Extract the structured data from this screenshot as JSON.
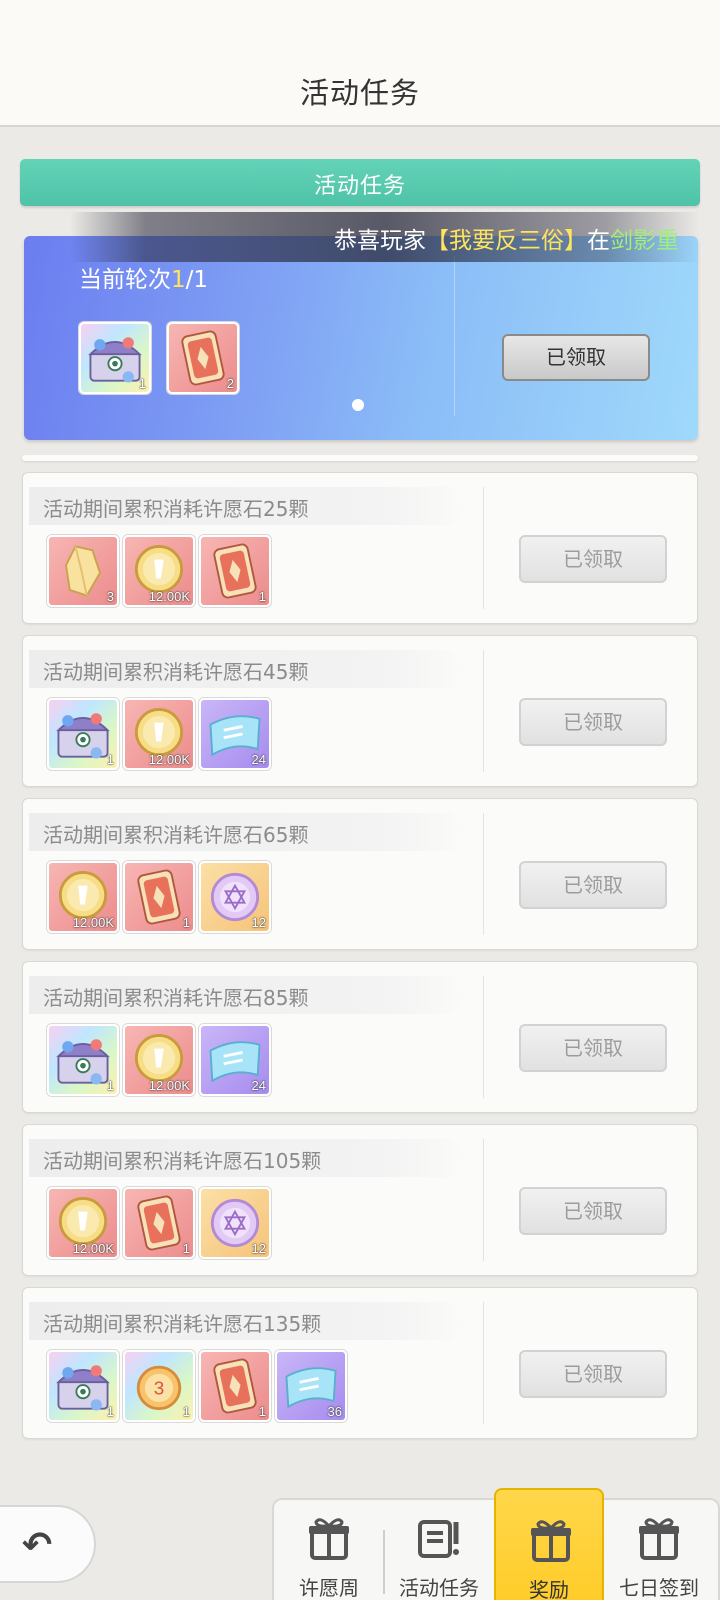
{
  "header": {
    "title": "活动任务"
  },
  "section_banner": {
    "label": "活动任务"
  },
  "marquee": {
    "prefix": "恭喜玩家",
    "player": "【我要反三俗】",
    "mid": "在",
    "place": "剑影重"
  },
  "round": {
    "label_prefix": "当前轮次",
    "current": "1",
    "total": "/1",
    "claim_label": "已领取",
    "rewards": [
      {
        "icon": "treasure-chest-icon",
        "count": "1",
        "bg": "rainbow"
      },
      {
        "icon": "red-ticket-icon",
        "count": "2",
        "bg": "pink"
      }
    ]
  },
  "tasks": [
    {
      "title": "活动期间累积消耗许愿石25颗",
      "claim_label": "已领取",
      "rewards": [
        {
          "icon": "crystal-icon",
          "count": "3",
          "bg": "pink"
        },
        {
          "icon": "gold-coin-icon",
          "count": "12.00K",
          "bg": "pink"
        },
        {
          "icon": "red-ticket-icon",
          "count": "1",
          "bg": "pink"
        }
      ]
    },
    {
      "title": "活动期间累积消耗许愿石45颗",
      "claim_label": "已领取",
      "rewards": [
        {
          "icon": "treasure-chest-icon",
          "count": "1",
          "bg": "rainbow"
        },
        {
          "icon": "gold-coin-icon",
          "count": "12.00K",
          "bg": "pink"
        },
        {
          "icon": "blue-ticket-icon",
          "count": "24",
          "bg": "purple"
        }
      ]
    },
    {
      "title": "活动期间累积消耗许愿石65颗",
      "claim_label": "已领取",
      "rewards": [
        {
          "icon": "gold-coin-icon",
          "count": "12.00K",
          "bg": "pink"
        },
        {
          "icon": "red-ticket-icon",
          "count": "1",
          "bg": "pink"
        },
        {
          "icon": "star-badge-icon",
          "count": "12",
          "bg": "orange"
        }
      ]
    },
    {
      "title": "活动期间累积消耗许愿石85颗",
      "claim_label": "已领取",
      "rewards": [
        {
          "icon": "treasure-chest-icon",
          "count": "1",
          "bg": "rainbow"
        },
        {
          "icon": "gold-coin-icon",
          "count": "12.00K",
          "bg": "pink"
        },
        {
          "icon": "blue-ticket-icon",
          "count": "24",
          "bg": "purple"
        }
      ]
    },
    {
      "title": "活动期间累积消耗许愿石105颗",
      "claim_label": "已领取",
      "rewards": [
        {
          "icon": "gold-coin-icon",
          "count": "12.00K",
          "bg": "pink"
        },
        {
          "icon": "red-ticket-icon",
          "count": "1",
          "bg": "pink"
        },
        {
          "icon": "star-badge-icon",
          "count": "12",
          "bg": "orange"
        }
      ]
    },
    {
      "title": "活动期间累积消耗许愿石135颗",
      "claim_label": "已领取",
      "rewards": [
        {
          "icon": "treasure-chest-icon",
          "count": "1",
          "bg": "rainbow"
        },
        {
          "icon": "number-medal-icon",
          "count": "1",
          "bg": "rainbow"
        },
        {
          "icon": "red-ticket-icon",
          "count": "1",
          "bg": "pink"
        },
        {
          "icon": "blue-ticket-icon",
          "count": "36",
          "bg": "purple"
        }
      ]
    }
  ],
  "bottom_nav": [
    {
      "label": "许愿周",
      "icon": "gift-icon",
      "active": false
    },
    {
      "label": "活动任务",
      "icon": "task-list-icon",
      "active": false
    },
    {
      "label": "奖励",
      "icon": "gift-icon",
      "active": true
    },
    {
      "label": "七日签到",
      "icon": "gift-icon",
      "active": false
    }
  ],
  "colors": {
    "accent_green": "#4fc3a7",
    "nav_active": "#ffcc2a",
    "highlight_yellow": "#ffe45c"
  }
}
